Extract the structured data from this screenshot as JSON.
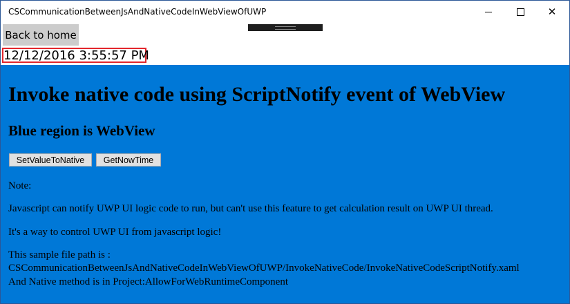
{
  "window": {
    "title": "CSCommunicationBetweenJsAndNativeCodeInWebViewOfUWP",
    "minimize_icon": "minimize-icon",
    "maximize_icon": "maximize-icon",
    "close_icon": "close-icon",
    "close_glyph": "✕"
  },
  "app": {
    "back_button_label": "Back to home",
    "current_time": "12/12/2016 3:55:57 PM",
    "highlight_color": "#e3262c"
  },
  "webview": {
    "background_color": "#0078d7",
    "heading": "Invoke native code using ScriptNotify event of WebView",
    "subheading": "Blue region is WebView",
    "buttons": {
      "set_value": "SetValueToNative",
      "get_time": "GetNowTime"
    },
    "note_label": "Note:",
    "paragraph_1": "Javascript can notify UWP UI logic code to run, but can't use this feature to get calculation result on UWP UI thread.",
    "paragraph_2": "It's a way to control UWP UI from javascript logic!",
    "path_line_1": "This sample file path is :",
    "path_line_2": "CSCommunicationBetweenJsAndNativeCodeInWebViewOfUWP/InvokeNativeCode/InvokeNativeCodeScriptNotify.xaml",
    "path_line_3": "And Native method is in Project:AllowForWebRuntimeComponent"
  }
}
